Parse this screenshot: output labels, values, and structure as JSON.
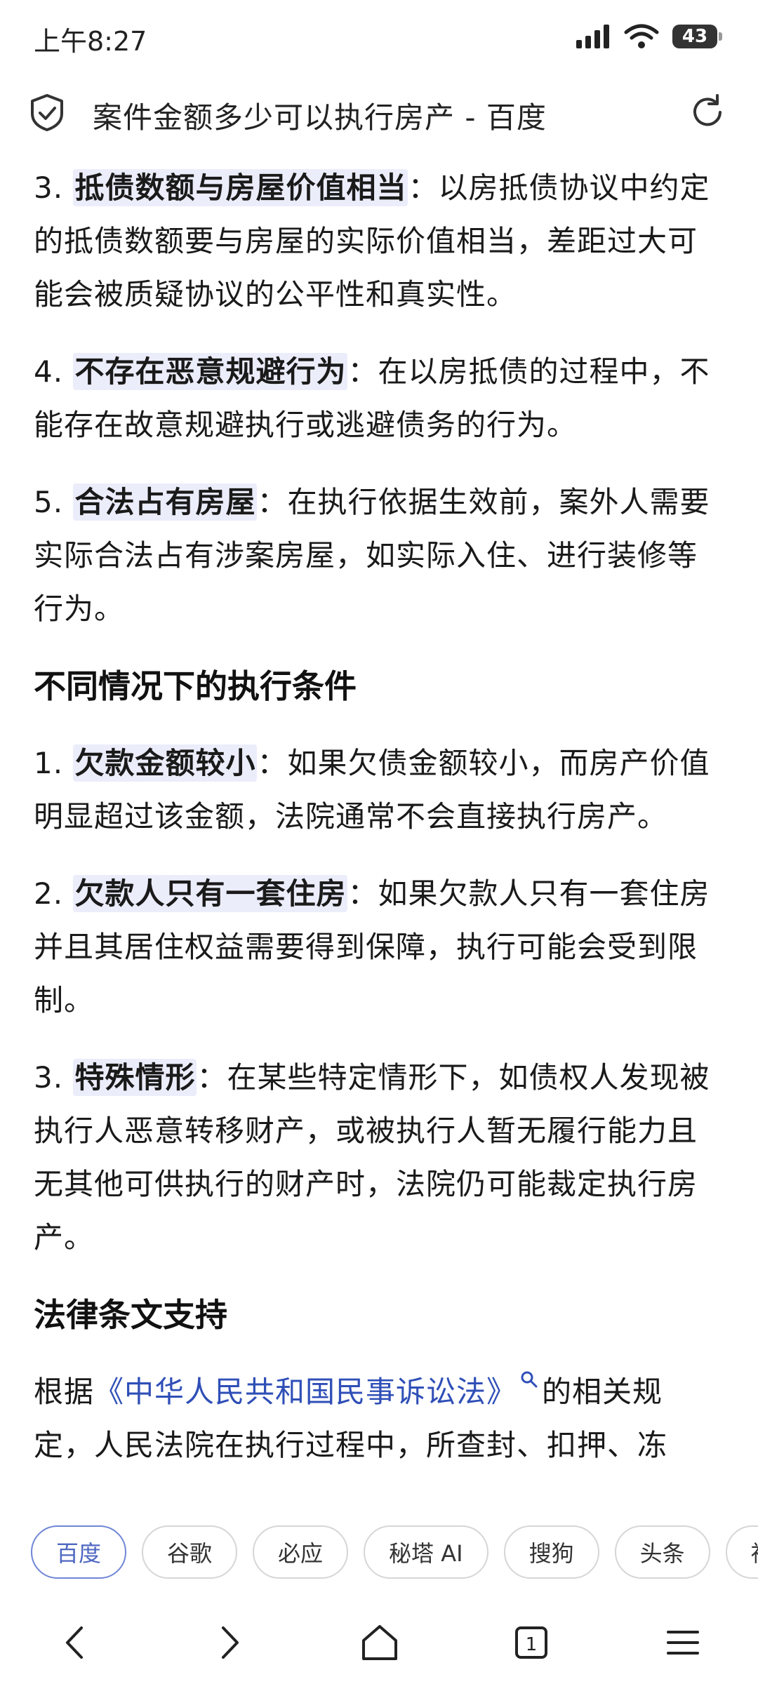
{
  "status": {
    "time": "上午8:27",
    "battery": "43"
  },
  "header": {
    "title": "案件金额多少可以执行房产 - 百度"
  },
  "content": {
    "items_a": [
      {
        "num": "3. ",
        "bold": "抵债数额与房屋价值相当",
        "text": "：以房抵债协议中约定的抵债数额要与房屋的实际价值相当，差距过大可能会被质疑协议的公平性和真实性。"
      },
      {
        "num": "4. ",
        "bold": "不存在恶意规避行为",
        "text": "：在以房抵债的过程中，不能存在故意规避执行或逃避债务的行为。"
      },
      {
        "num": "5. ",
        "bold": "合法占有房屋",
        "text": "：在执行依据生效前，案外人需要实际合法占有涉案房屋，如实际入住、进行装修等行为。"
      }
    ],
    "heading_1": "不同情况下的执行条件",
    "items_b": [
      {
        "num": "1. ",
        "bold": "欠款金额较小",
        "text": "：如果欠债金额较小，而房产价值明显超过该金额，法院通常不会直接执行房产。"
      },
      {
        "num": "2. ",
        "bold": "欠款人只有一套住房",
        "text": "：如果欠款人只有一套住房并且其居住权益需要得到保障，执行可能会受到限制。"
      },
      {
        "num": "3. ",
        "bold": "特殊情形",
        "text": "：在某些特定情形下，如债权人发现被执行人恶意转移财产，或被执行人暂无履行能力且无其他可供执行的财产时，法院仍可能裁定执行房产。"
      }
    ],
    "heading_2": "法律条文支持",
    "law": {
      "prefix": "根据",
      "link": "《中华人民共和国民事诉讼法》",
      "suffix": "的相关规定，人民法院在执行过程中，所查封、扣押、冻"
    }
  },
  "engines": [
    "百度",
    "谷歌",
    "必应",
    "秘塔 AI",
    "搜狗",
    "头条",
    "神马"
  ],
  "colors": {
    "highlight": "#ecedfb",
    "link": "#2f4fb7",
    "active_chip": "#4f67c2"
  }
}
